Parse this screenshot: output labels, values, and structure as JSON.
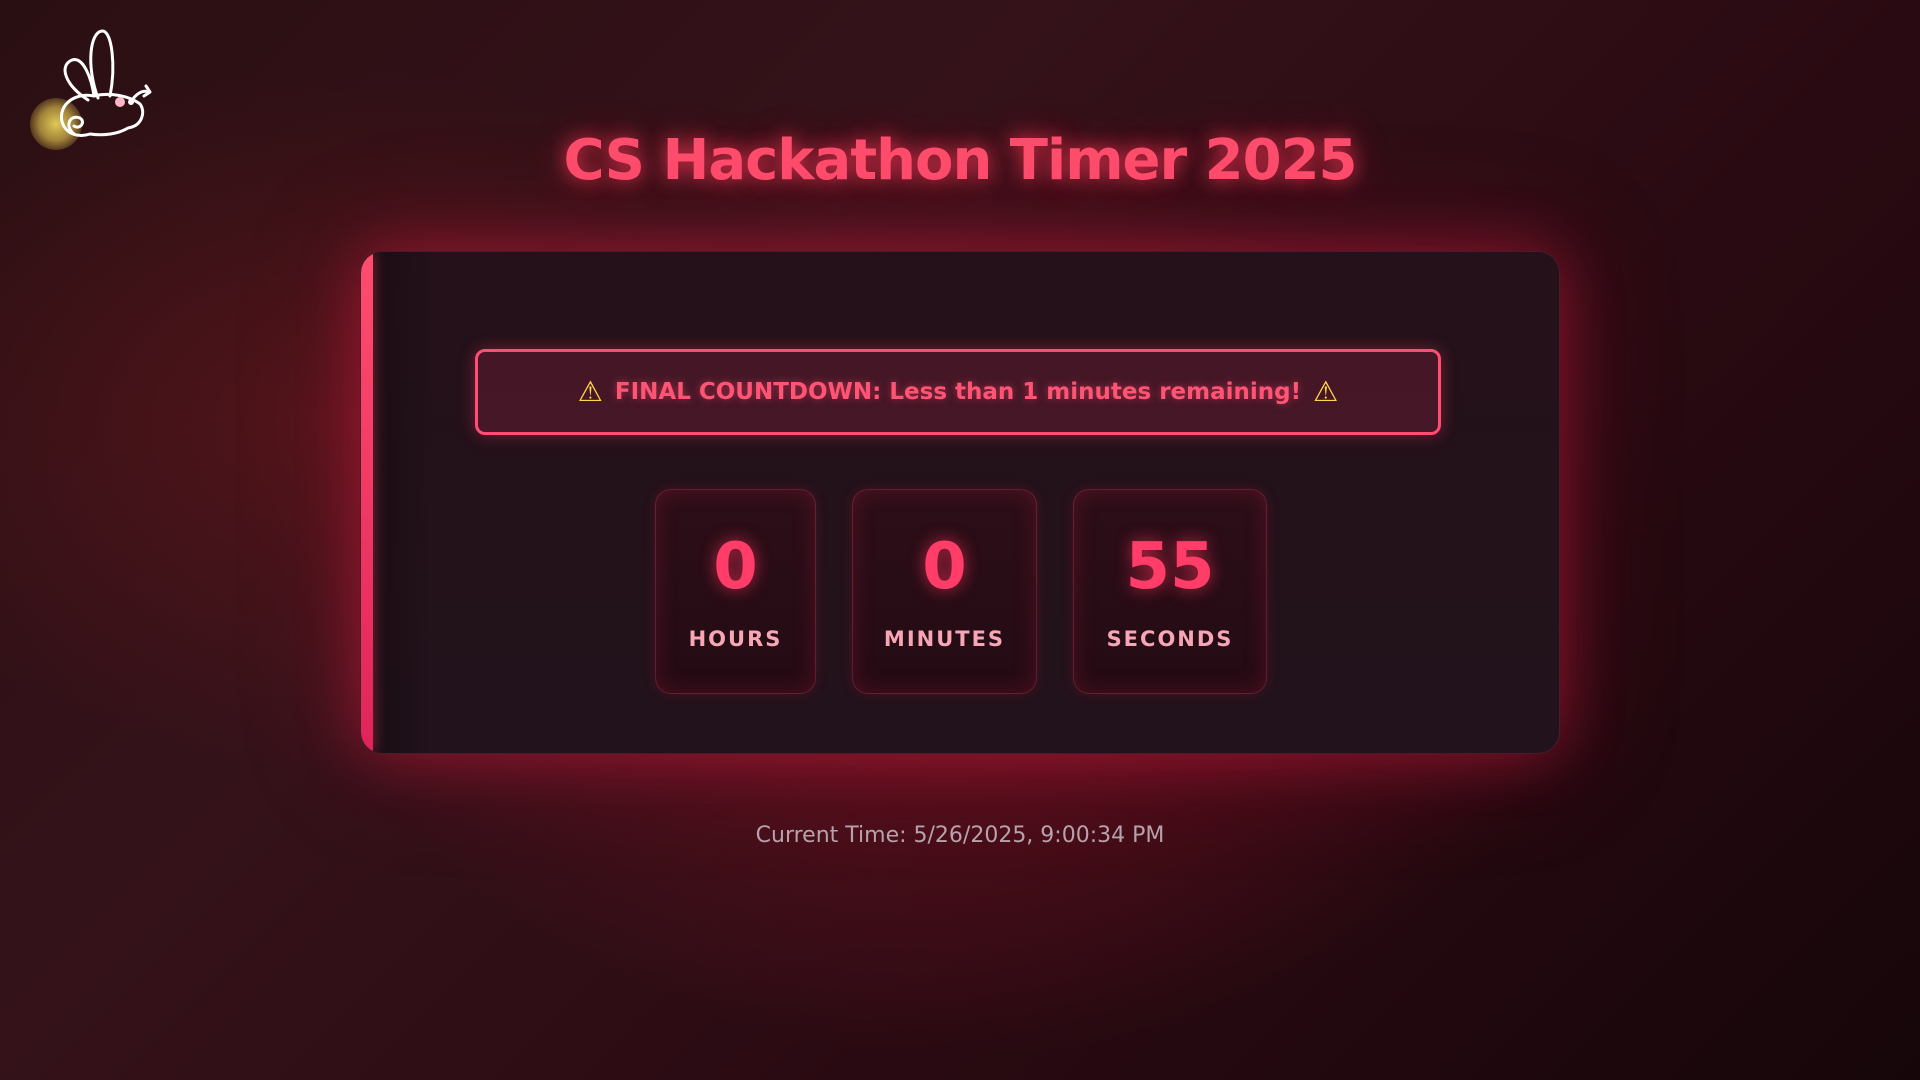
{
  "page": {
    "title": "CS Hackathon Timer 2025"
  },
  "warning": {
    "icon": "warning-triangle-icon",
    "text": "FINAL COUNTDOWN: Less than 1 minutes remaining!"
  },
  "countdown": {
    "hours": {
      "value": "0",
      "label": "HOURS"
    },
    "minutes": {
      "value": "0",
      "label": "MINUTES"
    },
    "seconds": {
      "value": "55",
      "label": "SECONDS"
    }
  },
  "footer": {
    "current_time": "Current Time: 5/26/2025, 9:00:34 PM"
  },
  "colors": {
    "accent": "#ff4d6d",
    "warning_icon": "#ffd54a",
    "label": "#f7a6b6",
    "muted_text": "#b6a2ab"
  },
  "icons": {
    "logo": "rabbit-logo-icon"
  }
}
